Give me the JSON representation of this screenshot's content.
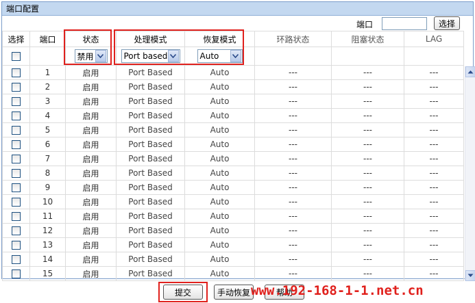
{
  "panel": {
    "title": "端口配置"
  },
  "search": {
    "label": "端口",
    "value": "",
    "button": "选择"
  },
  "columns": {
    "select": "选择",
    "port": "端口",
    "status": "状态",
    "mode": "处理模式",
    "recovery": "恢复模式",
    "loop": "环路状态",
    "block": "阻塞状态",
    "lag": "LAG"
  },
  "filters": {
    "status": "禁用",
    "mode": "Port based",
    "recovery": "Auto"
  },
  "rows": [
    {
      "port": "1",
      "status": "启用",
      "mode": "Port Based",
      "recovery": "Auto",
      "loop": "---",
      "block": "---",
      "lag": "---"
    },
    {
      "port": "2",
      "status": "启用",
      "mode": "Port Based",
      "recovery": "Auto",
      "loop": "---",
      "block": "---",
      "lag": "---"
    },
    {
      "port": "3",
      "status": "启用",
      "mode": "Port Based",
      "recovery": "Auto",
      "loop": "---",
      "block": "---",
      "lag": "---"
    },
    {
      "port": "4",
      "status": "启用",
      "mode": "Port Based",
      "recovery": "Auto",
      "loop": "---",
      "block": "---",
      "lag": "---"
    },
    {
      "port": "5",
      "status": "启用",
      "mode": "Port Based",
      "recovery": "Auto",
      "loop": "---",
      "block": "---",
      "lag": "---"
    },
    {
      "port": "6",
      "status": "启用",
      "mode": "Port Based",
      "recovery": "Auto",
      "loop": "---",
      "block": "---",
      "lag": "---"
    },
    {
      "port": "7",
      "status": "启用",
      "mode": "Port Based",
      "recovery": "Auto",
      "loop": "---",
      "block": "---",
      "lag": "---"
    },
    {
      "port": "8",
      "status": "启用",
      "mode": "Port Based",
      "recovery": "Auto",
      "loop": "---",
      "block": "---",
      "lag": "---"
    },
    {
      "port": "9",
      "status": "启用",
      "mode": "Port Based",
      "recovery": "Auto",
      "loop": "---",
      "block": "---",
      "lag": "---"
    },
    {
      "port": "10",
      "status": "启用",
      "mode": "Port Based",
      "recovery": "Auto",
      "loop": "---",
      "block": "---",
      "lag": "---"
    },
    {
      "port": "11",
      "status": "启用",
      "mode": "Port Based",
      "recovery": "Auto",
      "loop": "---",
      "block": "---",
      "lag": "---"
    },
    {
      "port": "12",
      "status": "启用",
      "mode": "Port Based",
      "recovery": "Auto",
      "loop": "---",
      "block": "---",
      "lag": "---"
    },
    {
      "port": "13",
      "status": "启用",
      "mode": "Port Based",
      "recovery": "Auto",
      "loop": "---",
      "block": "---",
      "lag": "---"
    },
    {
      "port": "14",
      "status": "启用",
      "mode": "Port Based",
      "recovery": "Auto",
      "loop": "---",
      "block": "---",
      "lag": "---"
    },
    {
      "port": "15",
      "status": "启用",
      "mode": "Port Based",
      "recovery": "Auto",
      "loop": "---",
      "block": "---",
      "lag": "---"
    }
  ],
  "buttons": {
    "submit": "提交",
    "manual_recover": "手动恢复",
    "help": "帮助"
  },
  "watermark": "www.192-168-1-1.net.cn",
  "colors": {
    "highlight": "#e0201c",
    "title_bar": "#c3d8f0",
    "border": "#7a9cc9"
  }
}
